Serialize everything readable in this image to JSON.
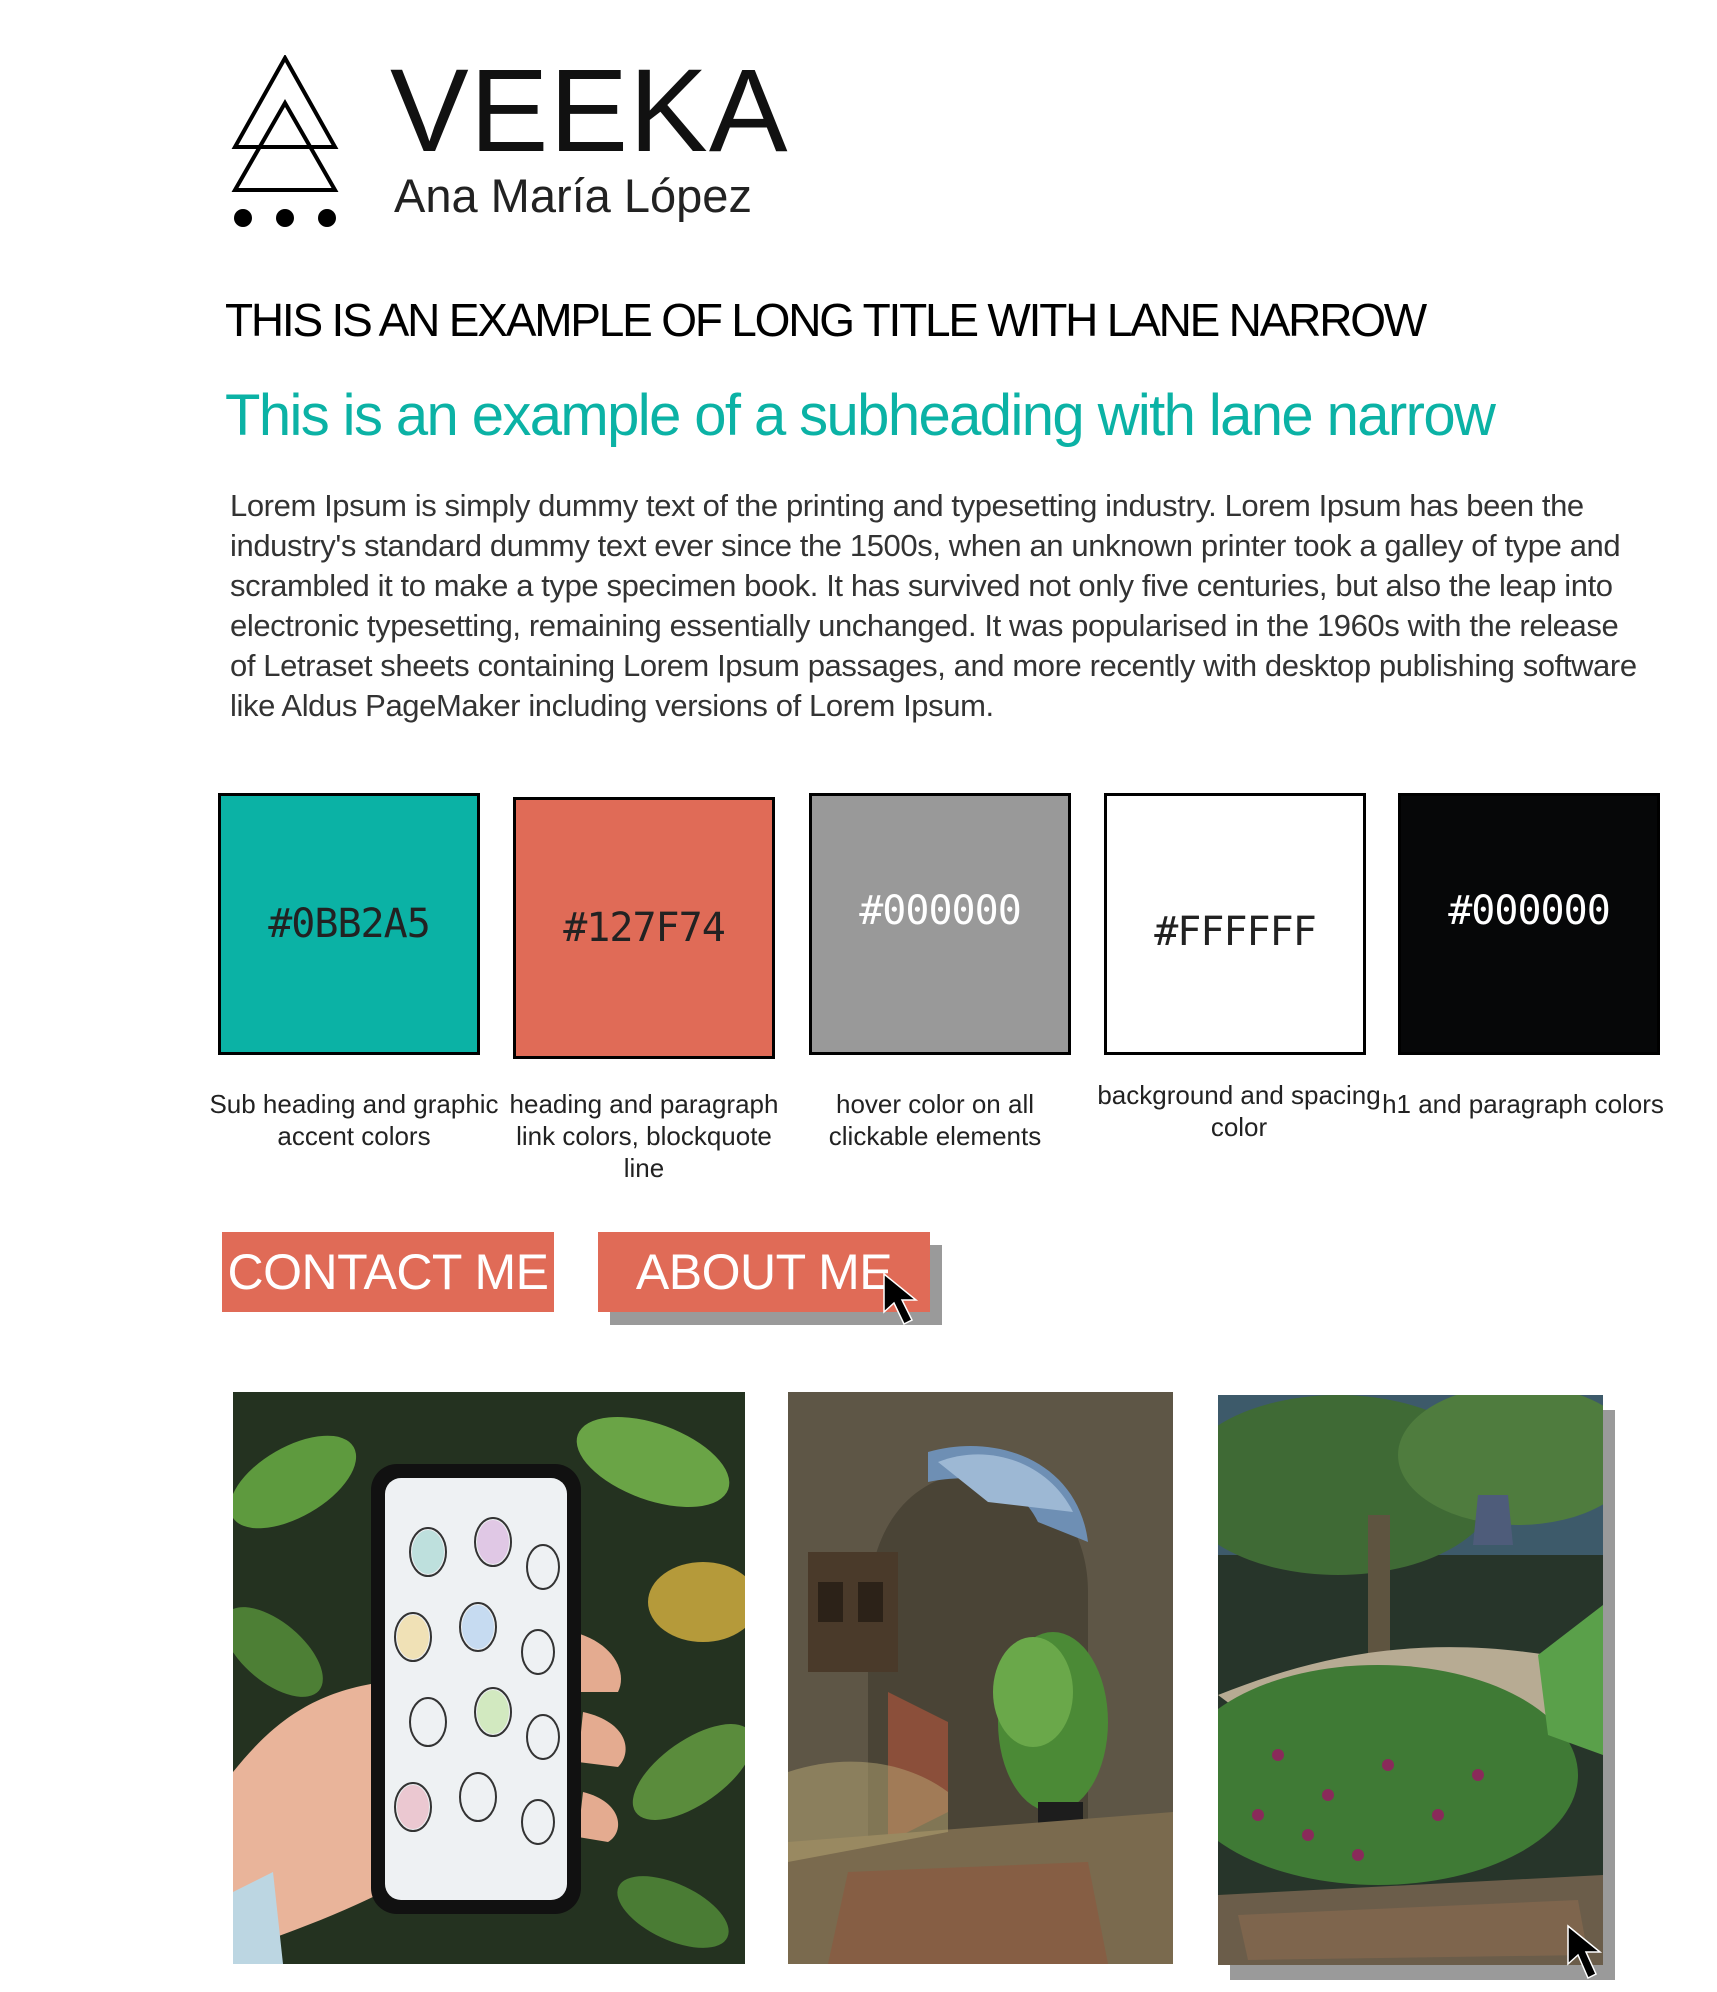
{
  "brand": {
    "name": "VEEKA",
    "subtitle": "Ana María López"
  },
  "page_title": "THIS IS AN EXAMPLE OF LONG TITLE WITH LANE NARROW",
  "sub_heading": "This is an example of a subheading with lane narrow",
  "body_text": "Lorem Ipsum is simply dummy text of the printing and typesetting industry. Lorem Ipsum has been the industry's standard dummy text ever since the 1500s, when an unknown printer took a galley of type and scrambled it to make a type specimen book. It has survived not only five centuries, but also the leap into electronic typesetting, remaining essentially unchanged. It was popularised in the 1960s with the release of Letraset sheets containing Lorem Ipsum passages, and more recently with desktop publishing software like Aldus PageMaker including versions of Lorem Ipsum.",
  "swatches": [
    {
      "hex_label": "#0BB2A5",
      "color": "#0bb2a5",
      "text_color": "#222222",
      "caption": "Sub heading and graphic accent colors"
    },
    {
      "hex_label": "#127F74",
      "color": "#e06b57",
      "text_color": "#222222",
      "caption": "heading and paragraph link colors, blockquote line"
    },
    {
      "hex_label": "#000000",
      "color": "#999999",
      "text_color": "#ffffff",
      "caption": "hover color on all clickable elements"
    },
    {
      "hex_label": "#FFFFFF",
      "color": "#ffffff",
      "text_color": "#222222",
      "caption": "background and spacing color"
    },
    {
      "hex_label": "#000000",
      "color": "#060708",
      "text_color": "#ffffff",
      "caption": "h1 and paragraph colors"
    }
  ],
  "buttons": {
    "contact": "CONTACT ME",
    "about": "ABOUT ME",
    "accent_color": "#e06b57"
  },
  "gallery": [
    {
      "name": "phone-case-photo"
    },
    {
      "name": "stone-archway-painting"
    },
    {
      "name": "garden-painting"
    }
  ],
  "icons": [
    "logo-triangles-icon",
    "cursor-arrow-icon"
  ]
}
